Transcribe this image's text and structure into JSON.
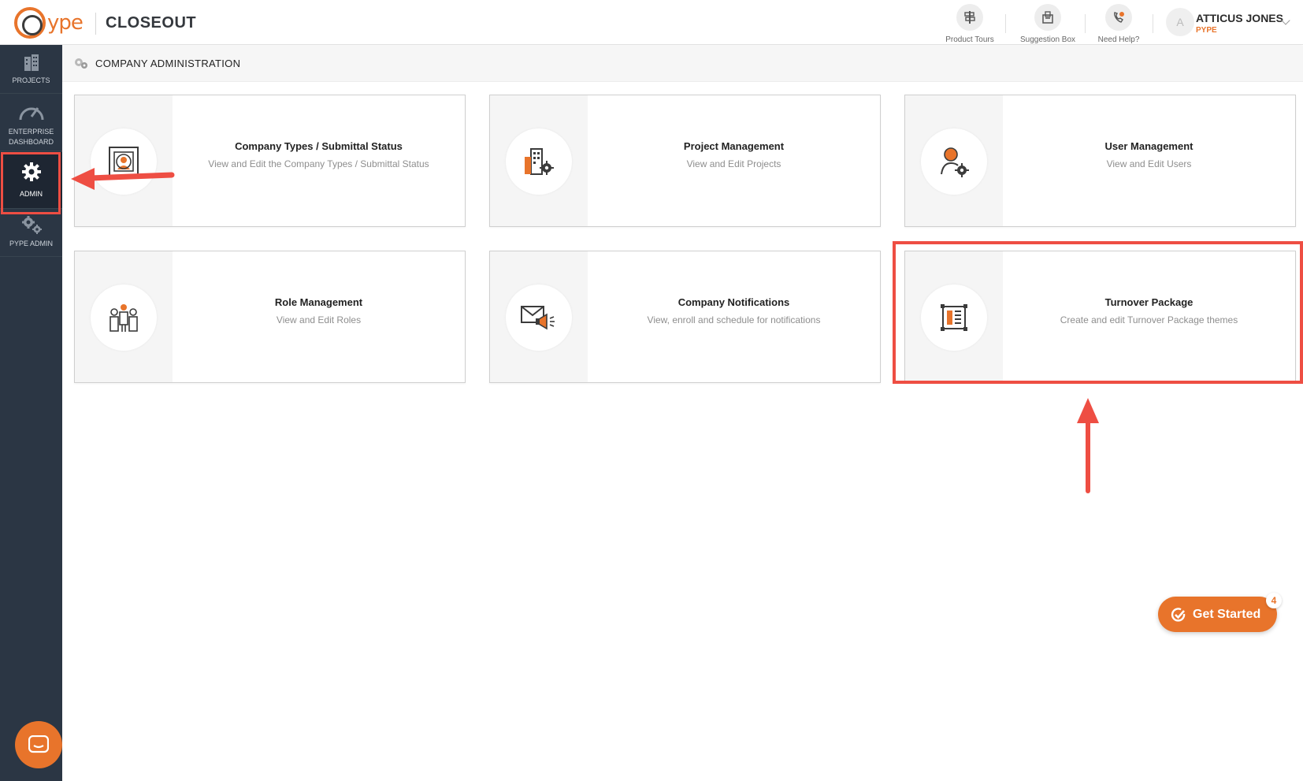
{
  "header": {
    "logo_text": "ype",
    "app_name": "CLOSEOUT",
    "tools": [
      {
        "label": "Product Tours",
        "icon": "signpost-icon"
      },
      {
        "label": "Suggestion Box",
        "icon": "suggestion-box-icon"
      },
      {
        "label": "Need Help?",
        "icon": "phone-help-icon"
      }
    ],
    "user": {
      "initial": "A",
      "name": "ATTICUS JONES",
      "org": "PYPE"
    }
  },
  "sidebar": {
    "items": [
      {
        "label": "PROJECTS",
        "icon": "building-icon"
      },
      {
        "label_line1": "ENTERPRISE",
        "label_line2": "DASHBOARD",
        "icon": "speedometer-icon"
      },
      {
        "label": "ADMIN",
        "icon": "gear-icon",
        "active": true
      },
      {
        "label": "PYPE ADMIN",
        "icon": "gears-icon"
      }
    ]
  },
  "page": {
    "title": "COMPANY ADMINISTRATION"
  },
  "cards": [
    {
      "title": "Company Types / Submittal Status",
      "desc": "View and Edit the Company Types / Submittal Status",
      "icon": "contact-card-icon"
    },
    {
      "title": "Project Management",
      "desc": "View and Edit Projects",
      "icon": "building-gear-icon"
    },
    {
      "title": "User Management",
      "desc": "View and Edit Users",
      "icon": "user-gear-icon"
    },
    {
      "title": "Role Management",
      "desc": "View and Edit Roles",
      "icon": "team-icon"
    },
    {
      "title": "Company Notifications",
      "desc": "View, enroll and schedule for notifications",
      "icon": "mail-megaphone-icon"
    },
    {
      "title": "Turnover Package",
      "desc": "Create and edit Turnover Package themes",
      "icon": "document-layout-icon"
    }
  ],
  "get_started": {
    "label": "Get Started",
    "badge": "4"
  },
  "colors": {
    "accent": "#e8742b",
    "sidebar": "#2b3644",
    "annotation": "#ee4e43"
  }
}
